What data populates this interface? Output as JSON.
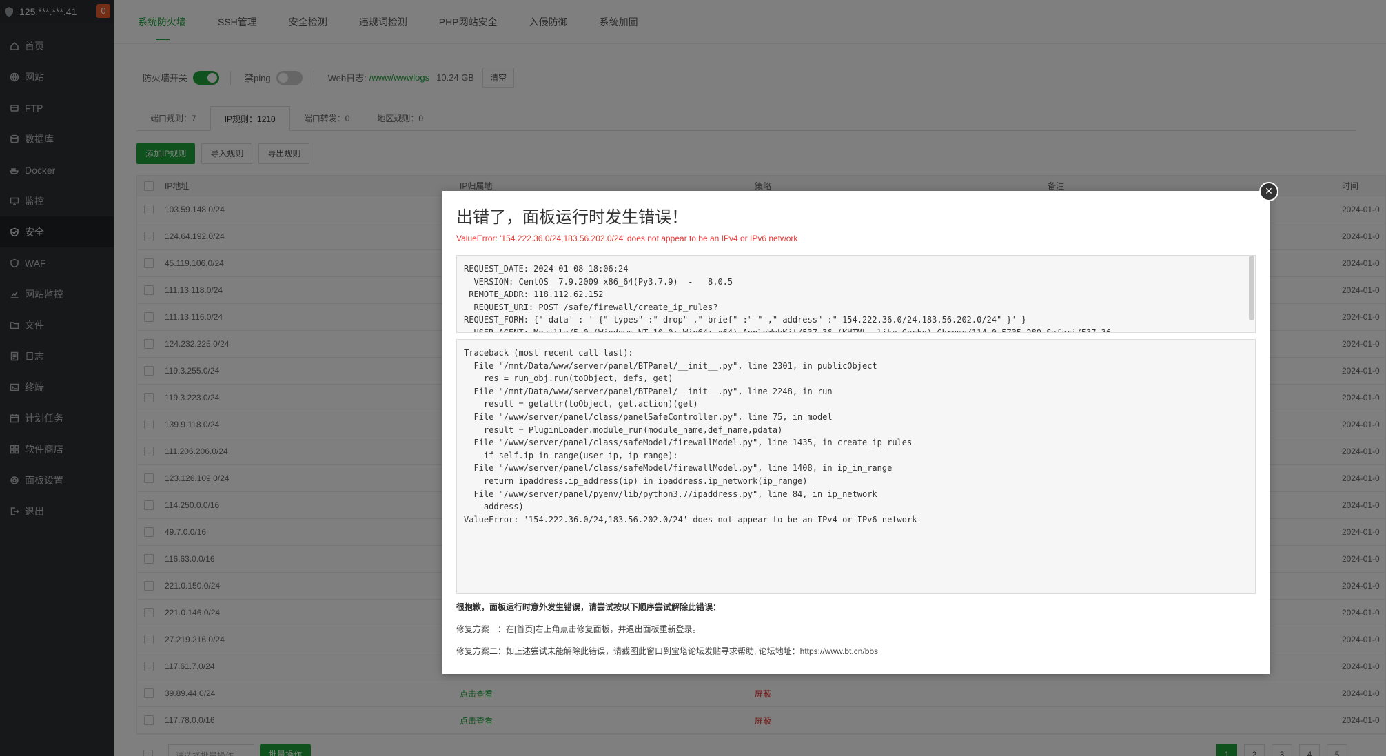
{
  "server": {
    "address": "125.***.***.41",
    "badge": "0"
  },
  "sidebar": {
    "items": [
      {
        "label": "首页",
        "icon": "home-icon"
      },
      {
        "label": "网站",
        "icon": "globe-icon"
      },
      {
        "label": "FTP",
        "icon": "ftp-icon"
      },
      {
        "label": "数据库",
        "icon": "database-icon"
      },
      {
        "label": "Docker",
        "icon": "docker-icon"
      },
      {
        "label": "监控",
        "icon": "monitor-icon"
      },
      {
        "label": "安全",
        "icon": "shield-icon",
        "active": true
      },
      {
        "label": "WAF",
        "icon": "waf-icon"
      },
      {
        "label": "网站监控",
        "icon": "site-monitor-icon"
      },
      {
        "label": "文件",
        "icon": "folder-icon"
      },
      {
        "label": "日志",
        "icon": "log-icon"
      },
      {
        "label": "终端",
        "icon": "terminal-icon"
      },
      {
        "label": "计划任务",
        "icon": "calendar-icon"
      },
      {
        "label": "软件商店",
        "icon": "apps-icon"
      },
      {
        "label": "面板设置",
        "icon": "gear-icon"
      },
      {
        "label": "退出",
        "icon": "logout-icon"
      }
    ]
  },
  "top_tabs": [
    "系统防火墙",
    "SSH管理",
    "安全检测",
    "违规词检测",
    "PHP网站安全",
    "入侵防御",
    "系统加固"
  ],
  "controls": {
    "firewall_label": "防火墙开关",
    "ping_label": "禁ping",
    "weblog_label": "Web日志:",
    "weblog_path": "/www/wwwlogs",
    "weblog_size": "10.24 GB",
    "clear_label": "清空"
  },
  "sub_tabs": [
    "端口规则：7",
    "IP规则：1210",
    "端口转发：0",
    "地区规则：0"
  ],
  "buttons": {
    "add": "添加IP规则",
    "import": "导入规则",
    "export": "导出规则"
  },
  "table": {
    "headers": {
      "ip": "IP地址",
      "loc": "IP归属地",
      "policy": "策略",
      "note": "备注",
      "time": "时间"
    },
    "rows": [
      {
        "ip": "103.59.148.0/24",
        "time": "2024-01-0"
      },
      {
        "ip": "124.64.192.0/24",
        "time": "2024-01-0"
      },
      {
        "ip": "45.119.106.0/24",
        "time": "2024-01-0"
      },
      {
        "ip": "111.13.118.0/24",
        "time": "2024-01-0"
      },
      {
        "ip": "111.13.116.0/24",
        "time": "2024-01-0"
      },
      {
        "ip": "124.232.225.0/24",
        "time": "2024-01-0"
      },
      {
        "ip": "119.3.255.0/24",
        "time": "2024-01-0"
      },
      {
        "ip": "119.3.223.0/24",
        "time": "2024-01-0"
      },
      {
        "ip": "139.9.118.0/24",
        "time": "2024-01-0"
      },
      {
        "ip": "111.206.206.0/24",
        "time": "2024-01-0"
      },
      {
        "ip": "123.126.109.0/24",
        "time": "2024-01-0"
      },
      {
        "ip": "114.250.0.0/16",
        "time": "2024-01-0"
      },
      {
        "ip": "49.7.0.0/16",
        "time": "2024-01-0"
      },
      {
        "ip": "116.63.0.0/16",
        "time": "2024-01-0"
      },
      {
        "ip": "221.0.150.0/24",
        "time": "2024-01-0"
      },
      {
        "ip": "221.0.146.0/24",
        "time": "2024-01-0"
      },
      {
        "ip": "27.219.216.0/24",
        "time": "2024-01-0"
      },
      {
        "ip": "117.61.7.0/24",
        "time": "2024-01-0"
      },
      {
        "ip": "39.89.44.0/24",
        "loc": "点击查看",
        "policy": "屏蔽",
        "time": "2024-01-0"
      },
      {
        "ip": "117.78.0.0/16",
        "loc": "点击查看",
        "policy": "屏蔽",
        "time": "2024-01-0"
      }
    ]
  },
  "bottom": {
    "select_placeholder": "请选择批量操作",
    "batch_label": "批量操作"
  },
  "pager": [
    "1",
    "2",
    "3",
    "4",
    "5"
  ],
  "modal": {
    "title": "出错了，面板运行时发生错误！",
    "error": "ValueError: '154.222.36.0/24,183.56.202.0/24' does not appear to be an IPv4 or IPv6 network",
    "request": "REQUEST_DATE: 2024-01-08 18:06:24\n  VERSION: CentOS  7.9.2009 x86_64(Py3.7.9)  -   8.0.5\n REMOTE_ADDR: 118.112.62.152\n  REQUEST_URI: POST /safe/firewall/create_ip_rules?\nREQUEST_FORM: {' data' : ' {\" types\" :\" drop\" ,\" brief\" :\" \" ,\" address\" :\" 154.222.36.0/24,183.56.202.0/24\" }' }\n  USER_AGENT: Mozilla/5.0 (Windows NT 10.0; Win64; x64) AppleWebKit/537.36 (KHTML, like Gecko) Chrome/114.0.5735.289 Safari/537.36",
    "traceback": "Traceback (most recent call last):\n  File \"/mnt/Data/www/server/panel/BTPanel/__init__.py\", line 2301, in publicObject\n    res = run_obj.run(toObject, defs, get)\n  File \"/mnt/Data/www/server/panel/BTPanel/__init__.py\", line 2248, in run\n    result = getattr(toObject, get.action)(get)\n  File \"/www/server/panel/class/panelSafeController.py\", line 75, in model\n    result = PluginLoader.module_run(module_name,def_name,pdata)\n  File \"/www/server/panel/class/safeModel/firewallModel.py\", line 1435, in create_ip_rules\n    if self.ip_in_range(user_ip, ip_range):\n  File \"/www/server/panel/class/safeModel/firewallModel.py\", line 1408, in ip_in_range\n    return ipaddress.ip_address(ip) in ipaddress.ip_network(ip_range)\n  File \"/www/server/panel/pyenv/lib/python3.7/ipaddress.py\", line 84, in ip_network\n    address)\nValueError: '154.222.36.0/24,183.56.202.0/24' does not appear to be an IPv4 or IPv6 network",
    "hint_title": "很抱歉，面板运行时意外发生错误，请尝试按以下顺序尝试解除此错误：",
    "hint_one": "修复方案一：在[首页]右上角点击修复面板，并退出面板重新登录。",
    "hint_two": "修复方案二：如上述尝试未能解除此错误，请截图此窗口到宝塔论坛发贴寻求帮助, 论坛地址：https://www.bt.cn/bbs",
    "close": "×"
  }
}
